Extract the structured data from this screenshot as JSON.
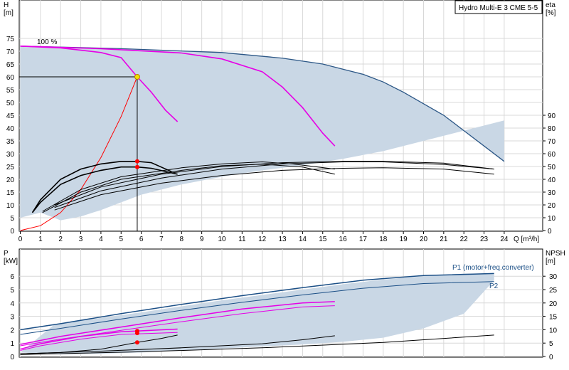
{
  "title": "Hydro Multi-E 3 CME 5-5",
  "colors": {
    "envelope_fill": "#c9d7e5",
    "envelope_edge": "#2c5786",
    "magenta": "#e600e6",
    "black": "#000000",
    "red": "#ff0000",
    "dark_blue": "#1b4f86",
    "duty_point": "#f5e000"
  },
  "chart_data": [
    {
      "type": "line",
      "name": "head",
      "ylabel_line1": "H",
      "ylabel_line2": "[m]",
      "y2label_line1": "eta",
      "y2label_line2": "[%]",
      "xlabel": "Q [m³/h]",
      "xlim": [
        0,
        24
      ],
      "xticks": [
        0,
        1,
        2,
        3,
        4,
        5,
        6,
        7,
        8,
        9,
        10,
        11,
        12,
        13,
        14,
        15,
        16,
        17,
        18,
        19,
        20,
        21,
        22,
        23,
        24
      ],
      "ylim": [
        0,
        80
      ],
      "yticks": [
        0,
        5,
        10,
        15,
        20,
        25,
        30,
        35,
        40,
        45,
        50,
        55,
        60,
        65,
        70,
        75
      ],
      "y2ticks": [
        0,
        10,
        20,
        30,
        40,
        50,
        60,
        70,
        80,
        90
      ],
      "speed_label": "100 %",
      "duty_point": {
        "q": 5.8,
        "h": 60
      },
      "envelope_top": [
        [
          0,
          72
        ],
        [
          5,
          71
        ],
        [
          10,
          69.5
        ],
        [
          13,
          67.3
        ],
        [
          15,
          65
        ],
        [
          16,
          63
        ],
        [
          17,
          61
        ],
        [
          18,
          58
        ],
        [
          19,
          54
        ],
        [
          20,
          49.5
        ],
        [
          21,
          45
        ],
        [
          22,
          39
        ],
        [
          23,
          33
        ],
        [
          24,
          27
        ]
      ],
      "envelope_bottom": [
        [
          0,
          5
        ],
        [
          0.5,
          6
        ],
        [
          1,
          7
        ],
        [
          2,
          4
        ],
        [
          3,
          5.5
        ],
        [
          4,
          8
        ],
        [
          5,
          11
        ],
        [
          6,
          14
        ],
        [
          8,
          18
        ],
        [
          10,
          21
        ],
        [
          12,
          23.5
        ],
        [
          14,
          25.5
        ],
        [
          16,
          28
        ],
        [
          18,
          31
        ],
        [
          20,
          35
        ],
        [
          22,
          39
        ],
        [
          24,
          43
        ]
      ],
      "series": [
        {
          "role": "head",
          "color": "magenta",
          "points": [
            [
              0,
              72
            ],
            [
              2,
              71.3
            ],
            [
              4,
              69.5
            ],
            [
              5,
              67.5
            ],
            [
              5.8,
              60
            ],
            [
              6.5,
              54
            ],
            [
              7.2,
              47
            ],
            [
              7.8,
              42.5
            ]
          ]
        },
        {
          "role": "head",
          "color": "magenta",
          "points": [
            [
              0,
              72
            ],
            [
              4,
              71
            ],
            [
              8,
              69.3
            ],
            [
              10,
              67
            ],
            [
              12,
              62
            ],
            [
              13,
              56
            ],
            [
              14,
              48
            ],
            [
              15,
              38
            ],
            [
              15.6,
              33
            ]
          ]
        },
        {
          "role": "system",
          "color": "red",
          "points": [
            [
              0,
              0
            ],
            [
              1,
              1.9
            ],
            [
              2,
              7
            ],
            [
              3,
              16
            ],
            [
              4,
              28.5
            ],
            [
              5,
              44.5
            ],
            [
              5.8,
              60
            ]
          ]
        },
        {
          "role": "eta",
          "color": "black",
          "points": [
            [
              0.6,
              7
            ],
            [
              1,
              12
            ],
            [
              2,
              20
            ],
            [
              3,
              24
            ],
            [
              4,
              26
            ],
            [
              5,
              27
            ],
            [
              5.8,
              27
            ],
            [
              6.5,
              26.5
            ],
            [
              7.5,
              23
            ]
          ]
        },
        {
          "role": "eta",
          "color": "black",
          "points": [
            [
              0.6,
              7
            ],
            [
              1,
              11
            ],
            [
              2,
              18
            ],
            [
              3,
              21.5
            ],
            [
              4,
              23.5
            ],
            [
              5,
              24.8
            ],
            [
              5.8,
              24.8
            ],
            [
              6.5,
              24.3
            ],
            [
              7.8,
              22
            ]
          ]
        },
        {
          "role": "eta",
          "color": "black",
          "points": [
            [
              1.1,
              7
            ],
            [
              3,
              15
            ],
            [
              5,
              20
            ],
            [
              8,
              23.5
            ],
            [
              10,
              25.3
            ],
            [
              12,
              25.9
            ],
            [
              14,
              24.8
            ],
            [
              15.6,
              22
            ]
          ]
        },
        {
          "role": "eta",
          "color": "black",
          "points": [
            [
              1.1,
              7.5
            ],
            [
              3,
              16
            ],
            [
              5,
              21
            ],
            [
              8,
              24.5
            ],
            [
              10,
              26
            ],
            [
              12,
              26.8
            ],
            [
              13.5,
              26
            ],
            [
              15.6,
              24
            ]
          ]
        },
        {
          "role": "eta",
          "color": "black",
          "points": [
            [
              1.7,
              8
            ],
            [
              4,
              14
            ],
            [
              7,
              18.5
            ],
            [
              10,
              21.5
            ],
            [
              13,
              23.5
            ],
            [
              16,
              24.3
            ],
            [
              18,
              24.5
            ],
            [
              21,
              24
            ],
            [
              23.5,
              22
            ]
          ]
        },
        {
          "role": "eta",
          "color": "black",
          "points": [
            [
              1.7,
              9
            ],
            [
              4,
              15.5
            ],
            [
              7,
              20.5
            ],
            [
              10,
              24
            ],
            [
              13,
              26
            ],
            [
              16,
              26.8
            ],
            [
              18,
              26.8
            ],
            [
              21,
              25.8
            ],
            [
              23.5,
              24
            ]
          ]
        },
        {
          "role": "eta",
          "color": "black",
          "points": [
            [
              1.7,
              10
            ],
            [
              4,
              17
            ],
            [
              7,
              22
            ],
            [
              10,
              25
            ],
            [
              13,
              26.5
            ],
            [
              16,
              27
            ],
            [
              18,
              27
            ],
            [
              21,
              26.3
            ],
            [
              23.5,
              24
            ]
          ]
        }
      ],
      "markers": [
        {
          "q": 5.8,
          "h": 27,
          "color": "red"
        },
        {
          "q": 5.8,
          "h": 24.8,
          "color": "red"
        }
      ]
    },
    {
      "type": "line",
      "name": "power",
      "ylabel_line1": "P",
      "ylabel_line2": "[kW]",
      "y2label_line1": "NPSH",
      "y2label_line2": "[m]",
      "xlim": [
        0,
        24
      ],
      "ylim": [
        0,
        7
      ],
      "yticks": [
        0,
        1,
        2,
        3,
        4,
        5,
        6
      ],
      "y2ticks": [
        0,
        5,
        10,
        15,
        20,
        25,
        30
      ],
      "series_labels": [
        "P1 (motor+freq.converter)",
        "P2"
      ],
      "envelope_top": [
        [
          1.7,
          2.4
        ],
        [
          6,
          3.3
        ],
        [
          10,
          4.2
        ],
        [
          13,
          4.8
        ],
        [
          16,
          5.4
        ],
        [
          18,
          5.75
        ],
        [
          20,
          6
        ],
        [
          22,
          6.2
        ],
        [
          23.5,
          6.2
        ]
      ],
      "envelope_bottom": [
        [
          0,
          0.3
        ],
        [
          2,
          0.15
        ],
        [
          4,
          0.2
        ],
        [
          6,
          0.3
        ],
        [
          8,
          0.45
        ],
        [
          10,
          0.6
        ],
        [
          12,
          0.75
        ],
        [
          14,
          0.9
        ],
        [
          16,
          1.1
        ],
        [
          18,
          1.4
        ],
        [
          20,
          2.1
        ],
        [
          22,
          3.2
        ],
        [
          23.5,
          5.7
        ]
      ],
      "series": [
        {
          "role": "P1",
          "color": "dark_blue",
          "points": [
            [
              0,
              2
            ],
            [
              2,
              2.45
            ],
            [
              5,
              3.2
            ],
            [
              8,
              3.9
            ],
            [
              11,
              4.55
            ],
            [
              14,
              5.15
            ],
            [
              17,
              5.7
            ],
            [
              20,
              6.05
            ],
            [
              23.5,
              6.2
            ]
          ]
        },
        {
          "role": "P2",
          "color": "dark_blue",
          "points": [
            [
              0,
              1.65
            ],
            [
              2,
              2.1
            ],
            [
              5,
              2.8
            ],
            [
              8,
              3.45
            ],
            [
              11,
              4.05
            ],
            [
              14,
              4.6
            ],
            [
              17,
              5.1
            ],
            [
              20,
              5.45
            ],
            [
              23.5,
              5.6
            ]
          ]
        },
        {
          "role": "P1",
          "color": "magenta",
          "points": [
            [
              0,
              0.9
            ],
            [
              2,
              1.5
            ],
            [
              5,
              2.2
            ],
            [
              8,
              2.9
            ],
            [
              11,
              3.55
            ],
            [
              14,
              4
            ],
            [
              15.6,
              4.1
            ]
          ]
        },
        {
          "role": "P2",
          "color": "magenta",
          "points": [
            [
              0,
              0.8
            ],
            [
              2,
              1.3
            ],
            [
              5,
              1.95
            ],
            [
              8,
              2.6
            ],
            [
              11,
              3.2
            ],
            [
              14,
              3.7
            ],
            [
              15.6,
              3.8
            ]
          ]
        },
        {
          "role": "P1",
          "color": "magenta",
          "points": [
            [
              0,
              0.55
            ],
            [
              1,
              0.95
            ],
            [
              3,
              1.5
            ],
            [
              5,
              1.85
            ],
            [
              7.8,
              2.05
            ]
          ]
        },
        {
          "role": "P2",
          "color": "magenta",
          "points": [
            [
              0,
              0.45
            ],
            [
              1,
              0.8
            ],
            [
              3,
              1.3
            ],
            [
              5,
              1.65
            ],
            [
              7.8,
              1.8
            ]
          ]
        },
        {
          "role": "NPSH",
          "color": "black",
          "points": [
            [
              0,
              0.2
            ],
            [
              2,
              0.3
            ],
            [
              4,
              0.55
            ],
            [
              5.8,
              1.05
            ],
            [
              7,
              1.35
            ],
            [
              7.8,
              1.6
            ]
          ]
        },
        {
          "role": "NPSH",
          "color": "black",
          "points": [
            [
              0,
              0.2
            ],
            [
              4,
              0.4
            ],
            [
              8,
              0.65
            ],
            [
              12,
              0.95
            ],
            [
              14,
              1.25
            ],
            [
              15.6,
              1.55
            ]
          ]
        },
        {
          "role": "NPSH",
          "color": "black",
          "points": [
            [
              0,
              0.15
            ],
            [
              6,
              0.35
            ],
            [
              12,
              0.65
            ],
            [
              18,
              1.05
            ],
            [
              23.5,
              1.6
            ]
          ]
        }
      ],
      "markers": [
        {
          "q": 5.8,
          "p": 1.9,
          "color": "red"
        },
        {
          "q": 5.8,
          "p": 1.75,
          "color": "red"
        },
        {
          "q": 5.8,
          "p": 1.05,
          "color": "red"
        }
      ]
    }
  ]
}
